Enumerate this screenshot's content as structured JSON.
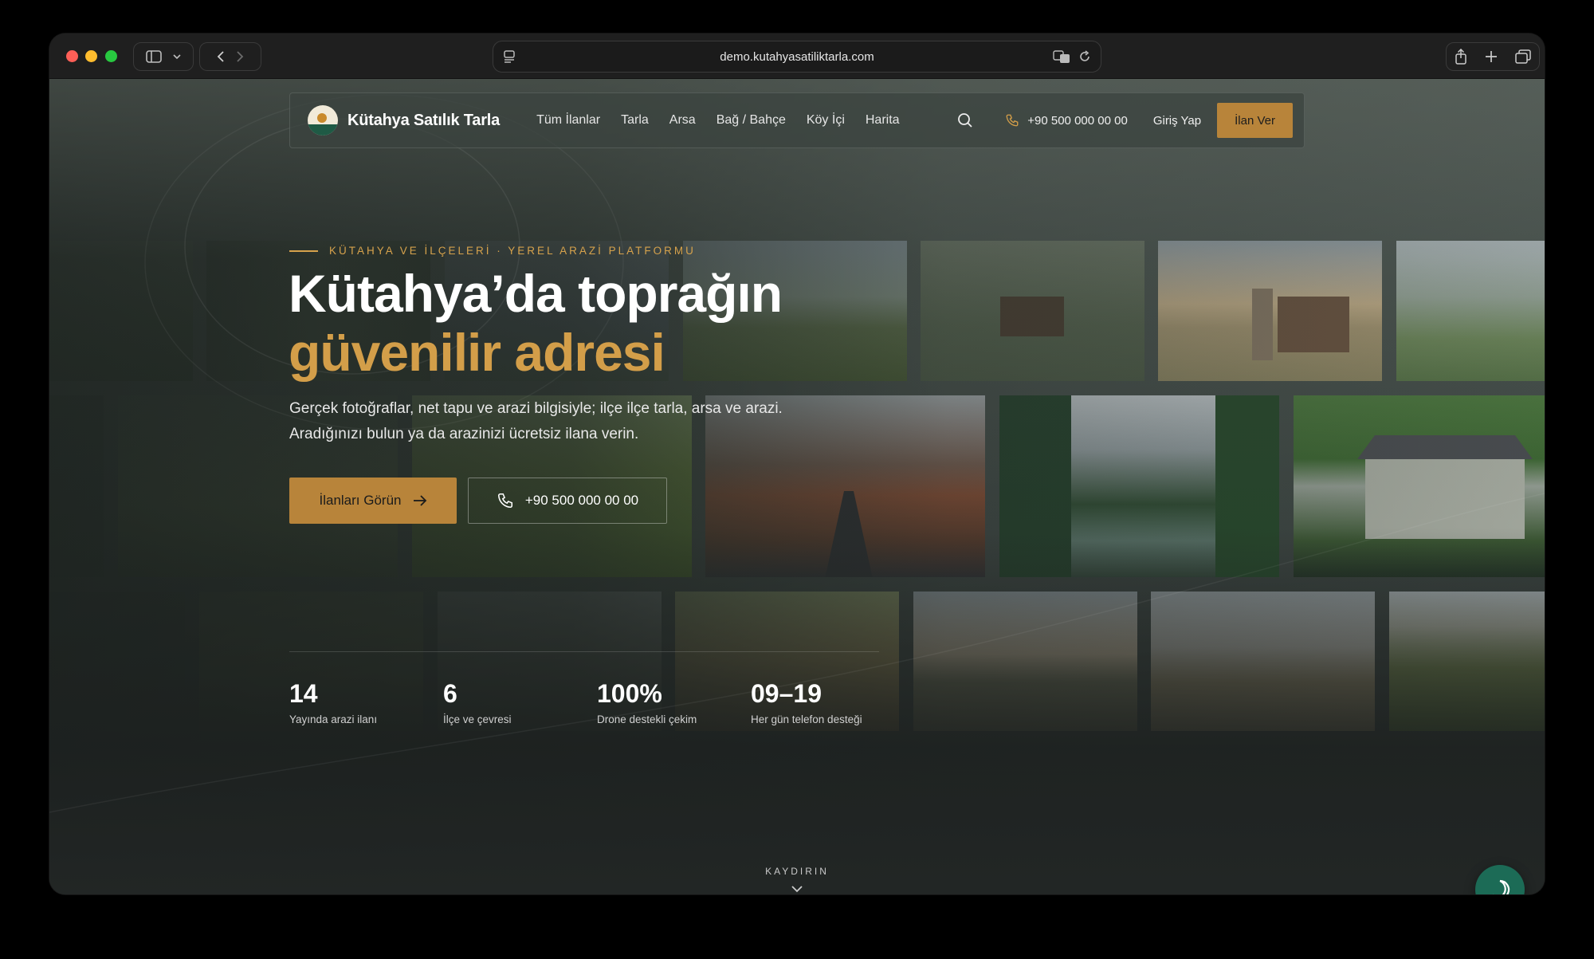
{
  "browser": {
    "url": "demo.kutahyasatiliktarla.com"
  },
  "nav": {
    "brand": "Kütahya Satılık Tarla",
    "links": [
      "Tüm İlanlar",
      "Tarla",
      "Arsa",
      "Bağ / Bahçe",
      "Köy İçi",
      "Harita"
    ],
    "phone": "+90 500 000 00 00",
    "login": "Giriş Yap",
    "cta": "İlan Ver"
  },
  "hero": {
    "eyebrow": "KÜTAHYA VE İLÇELERİ · YEREL ARAZİ PLATFORMU",
    "title_line1": "Kütahya’da toprağın",
    "title_line2": "güvenilir adresi",
    "lead": "Gerçek fotoğraflar, net tapu ve arazi bilgisiyle; ilçe ilçe tarla, arsa ve arazi. Aradığınızı bulun ya da arazinizi ücretsiz ilana verin.",
    "primary_button": "İlanları Görün",
    "secondary_button": "+90 500 000 00 00"
  },
  "stats": [
    {
      "value": "14",
      "label": "Yayında arazi ilanı"
    },
    {
      "value": "6",
      "label": "İlçe ve çevresi"
    },
    {
      "value": "100%",
      "label": "Drone destekli çekim"
    },
    {
      "value": "09–19",
      "label": "Her gün telefon desteği"
    }
  ],
  "scroll_hint": "KAYDIRIN",
  "colors": {
    "accent": "#b8843a",
    "accent_text": "#d39e49",
    "chat": "#1c6b56"
  }
}
